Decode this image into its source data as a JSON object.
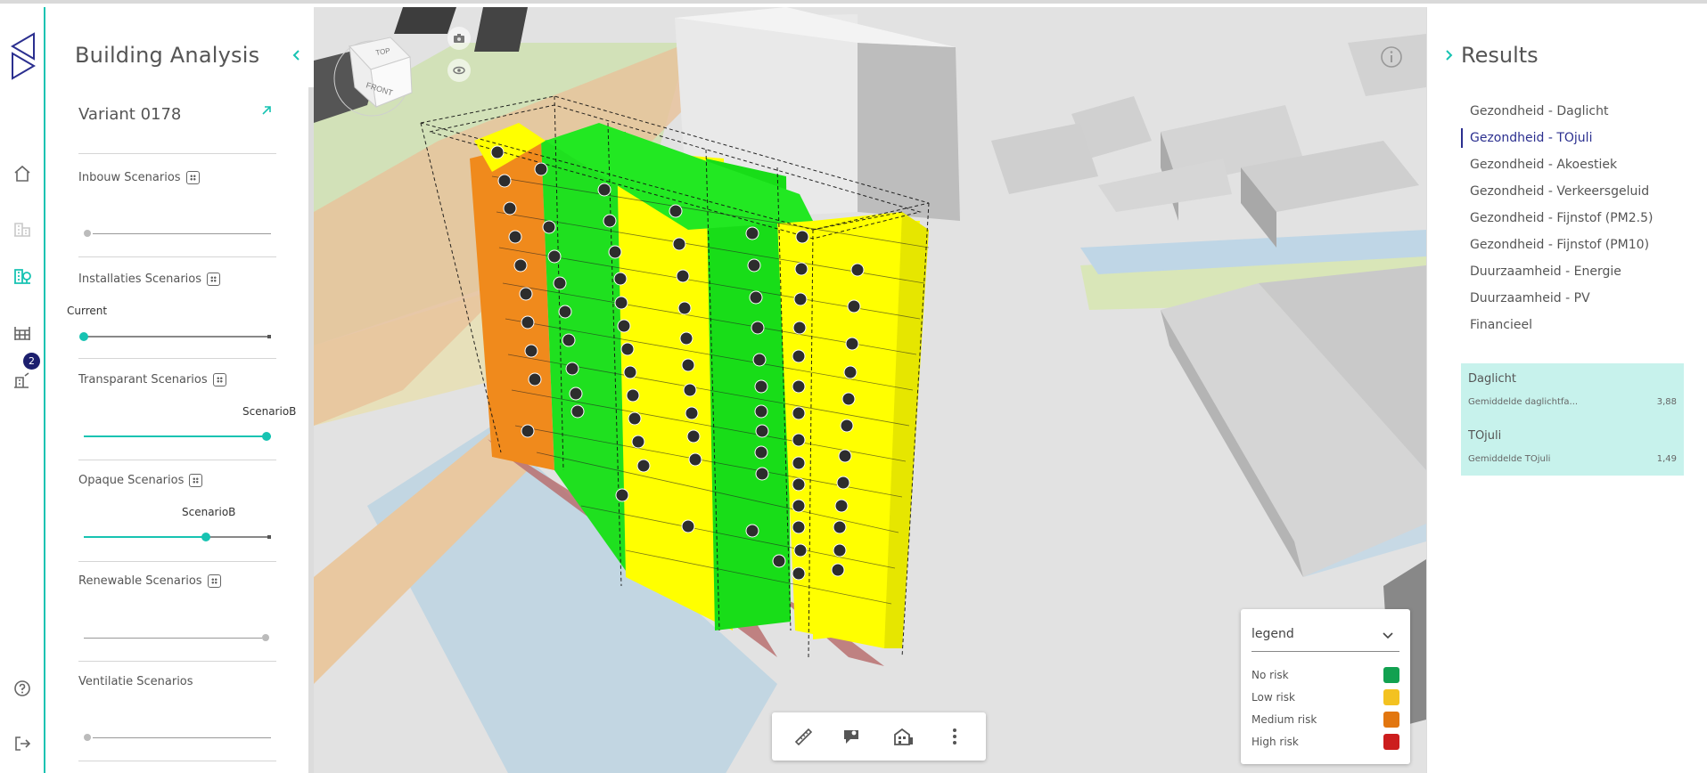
{
  "rail": {
    "badge": "2"
  },
  "panel": {
    "title": "Building Analysis",
    "variant": "Variant 0178",
    "scenarios": [
      {
        "label": "Inbouw Scenarios",
        "value_label": "",
        "level": 0.0
      },
      {
        "label": "Installaties Scenarios",
        "value_label": "Current",
        "level": 0.0
      },
      {
        "label": "Transparant Scenarios",
        "value_label": "ScenarioB",
        "level": 1.0
      },
      {
        "label": "Opaque Scenarios",
        "value_label": "ScenarioB",
        "level": 0.67
      },
      {
        "label": "Renewable Scenarios",
        "value_label": "",
        "level": 1.0
      },
      {
        "label": "Ventilatie Scenarios",
        "value_label": "",
        "level": 0.0
      }
    ]
  },
  "viewport": {
    "nav_cube": {
      "top": "TOP",
      "front": "FRONT"
    }
  },
  "legend": {
    "title": "legend",
    "items": [
      {
        "label": "No risk",
        "color": "#12a150"
      },
      {
        "label": "Low risk",
        "color": "#f3c221"
      },
      {
        "label": "Medium risk",
        "color": "#e2760f"
      },
      {
        "label": "High risk",
        "color": "#cc1d1d"
      }
    ]
  },
  "results": {
    "title": "Results",
    "items": [
      {
        "label": "Gezondheid - Daglicht",
        "active": false
      },
      {
        "label": "Gezondheid - TOjuli",
        "active": true
      },
      {
        "label": "Gezondheid - Akoestiek",
        "active": false
      },
      {
        "label": "Gezondheid - Verkeersgeluid",
        "active": false
      },
      {
        "label": "Gezondheid - Fijnstof (PM2.5)",
        "active": false
      },
      {
        "label": "Gezondheid - Fijnstof (PM10)",
        "active": false
      },
      {
        "label": "Duurzaamheid - Energie",
        "active": false
      },
      {
        "label": "Duurzaamheid - PV",
        "active": false
      },
      {
        "label": "Financieel",
        "active": false
      }
    ],
    "summary": [
      {
        "heading": "Daglicht",
        "metric": "Gemiddelde daglichtfa...",
        "value": "3,88"
      },
      {
        "heading": "TOjuli",
        "metric": "Gemiddelde TOjuli",
        "value": "1,49"
      }
    ]
  },
  "colors": {
    "accent": "#17c3b2",
    "primary_dark": "#1c1f6e",
    "summary_bg": "#c7f2ec"
  }
}
